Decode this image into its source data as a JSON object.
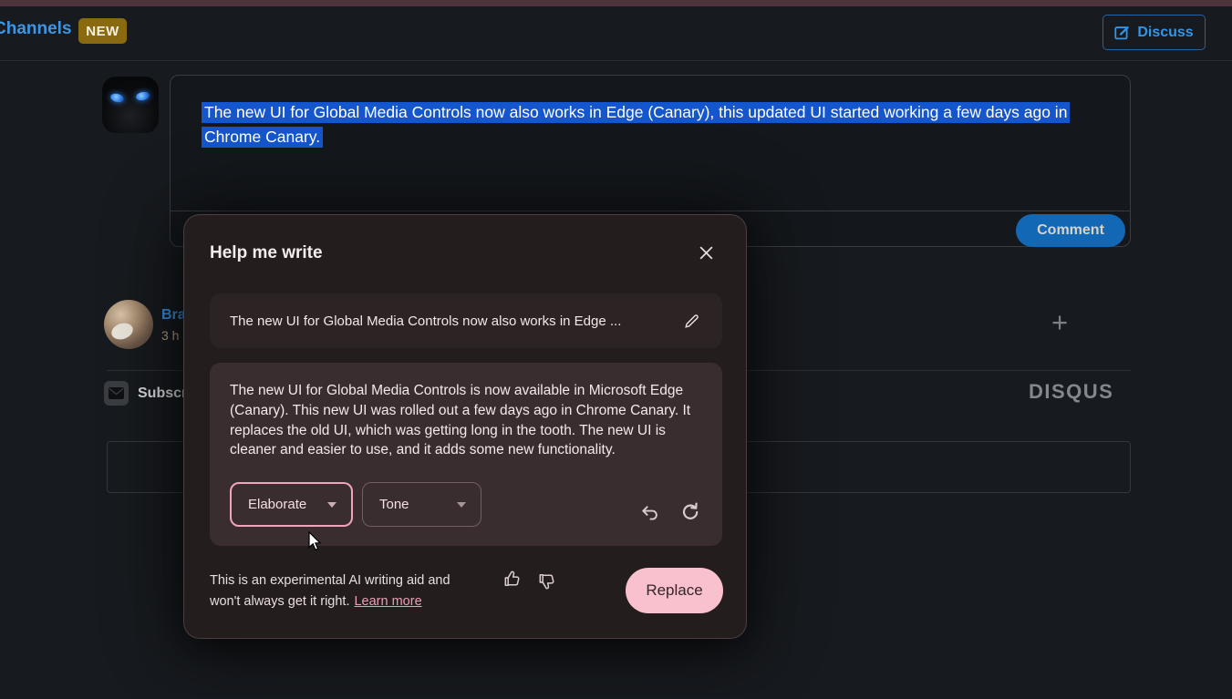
{
  "header": {
    "channels_label": "Channels",
    "new_badge": "NEW",
    "discuss_label": "Discuss"
  },
  "composer": {
    "selected_text": "The new UI for Global Media Controls now also works in Edge (Canary), this updated UI started working a few days ago in Chrome Canary.",
    "comment_button": "Comment"
  },
  "thread": {
    "username_visible": "Bra",
    "timestamp_visible": "3 h",
    "subscribe_visible": "Subscr",
    "disqus_logo": "DISQUS",
    "plus_icon": "+"
  },
  "dialog": {
    "title": "Help me write",
    "input_preview": "The new UI for Global Media Controls now also works in Edge ...",
    "generated_text": "The new UI for Global Media Controls is now available in Microsoft Edge (Canary). This new UI was rolled out a few days ago in Chrome Canary. It replaces the old UI, which was getting long in the tooth. The new UI is cleaner and easier to use, and it adds some new functionality.",
    "dropdowns": [
      {
        "label": "Elaborate",
        "active": true
      },
      {
        "label": "Tone",
        "active": false
      }
    ],
    "disclaimer_line1": "This is an experimental AI writing aid and",
    "disclaimer_line2": "won't always get it right.",
    "learn_more": "Learn more",
    "replace_button": "Replace"
  },
  "icons": {
    "discuss_button": "compose-icon",
    "dialog_close": "x-icon",
    "prompt_edit": "pencil-icon",
    "undo": "undo-arrow-icon",
    "regenerate": "redo-arrow-icon",
    "feedback_up": "thumb-up-icon",
    "feedback_down": "thumb-down-icon",
    "subscribe": "envelope-icon",
    "add": "plus-icon"
  },
  "colors": {
    "accent_blue": "#3c96e8",
    "selection_blue": "#1456cd",
    "comment_button_blue": "#1268b4",
    "dialog_bg": "#241d1e",
    "accent_pink_border": "#f0a6ba",
    "replace_pink": "#f9c0cd",
    "new_badge_gold": "#8a6a10",
    "top_strip_maroon": "#4c343a",
    "page_bg": "#171a1e"
  }
}
